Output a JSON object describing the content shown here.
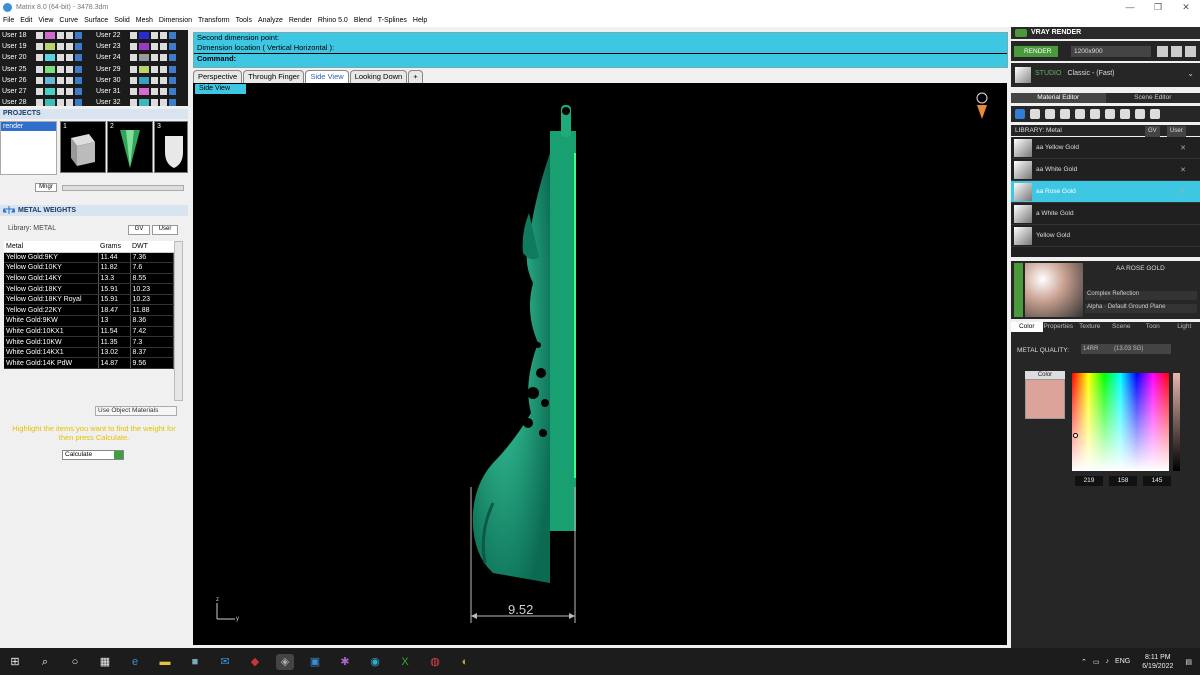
{
  "window": {
    "title": "Matrix 8.0 (64-bit) - 3478.3dm",
    "min": "—",
    "max": "❐",
    "close": "✕"
  },
  "menu": [
    "File",
    "Edit",
    "View",
    "Curve",
    "Surface",
    "Solid",
    "Mesh",
    "Dimension",
    "Transform",
    "Tools",
    "Analyze",
    "Render",
    "Rhino 5.0",
    "Blend",
    "T-Splines",
    "Help"
  ],
  "layers": {
    "left": [
      {
        "name": "User 18",
        "color": "#d26ad2"
      },
      {
        "name": "User 19",
        "color": "#b8d46a"
      },
      {
        "name": "User 20",
        "color": "#5ad4e0"
      },
      {
        "name": "User 25",
        "color": "#7ae07a"
      },
      {
        "name": "User 26",
        "color": "#6ab8d4"
      },
      {
        "name": "User 27",
        "color": "#4ad0c0"
      },
      {
        "name": "User 28",
        "color": "#3ac0b8"
      }
    ],
    "right": [
      {
        "name": "User 22",
        "color": "#2a2ad0"
      },
      {
        "name": "User 23",
        "color": "#9a3ac8"
      },
      {
        "name": "User 24",
        "color": "#9a9a9a"
      },
      {
        "name": "User 29",
        "color": "#c0d06a"
      },
      {
        "name": "User 30",
        "color": "#3aa0c0"
      },
      {
        "name": "User 31",
        "color": "#d66ad0"
      },
      {
        "name": "User 32",
        "color": "#3ab8c0"
      }
    ]
  },
  "projects": {
    "header": "PROJECTS",
    "item": "render",
    "thumbs": [
      "1",
      "2",
      "3"
    ],
    "mngr": "Mngr"
  },
  "metal_weights": {
    "header": "METAL WEIGHTS",
    "library": "Library: METAL",
    "gv": "GV",
    "user": "User",
    "columns": [
      "Metal",
      "Grams",
      "DWT"
    ],
    "rows": [
      [
        "Yellow Gold:9KY",
        "11.44",
        "7.36"
      ],
      [
        "Yellow Gold:10KY",
        "11.82",
        "7.6"
      ],
      [
        "Yellow Gold:14KY",
        "13.3",
        "8.55"
      ],
      [
        "Yellow Gold:18KY",
        "15.91",
        "10.23"
      ],
      [
        "Yellow Gold:18KY Royal",
        "15.91",
        "10.23"
      ],
      [
        "Yellow Gold:22KY",
        "18.47",
        "11.88"
      ],
      [
        "White Gold:9KW",
        "13",
        "8.36"
      ],
      [
        "White Gold:10KX1",
        "11.54",
        "7.42"
      ],
      [
        "White Gold:10KW",
        "11.35",
        "7.3"
      ],
      [
        "White Gold:14KX1",
        "13.02",
        "8.37"
      ],
      [
        "White Gold:14K PdW",
        "14.87",
        "9.56"
      ]
    ],
    "use_object": "Use Object Materials",
    "hint": "Highlight the items you want to find the weight for then press Calculate.",
    "calculate": "Calculate"
  },
  "command": {
    "line1": "Second dimension point:",
    "line2": "Dimension location ( Vertical  Horizontal ):",
    "prompt": "Command:"
  },
  "view_tabs": [
    "Perspective",
    "Through Finger",
    "Side View",
    "Looking Down",
    "+"
  ],
  "viewport": {
    "label": "Side View",
    "dimension": "9.52",
    "axis_z": "z",
    "axis_y": "y"
  },
  "vray": {
    "header": "VRAY RENDER",
    "render": "RENDER",
    "resolution": "1200x900",
    "preset_mode": "STUDIO",
    "preset": "Classic - (Fast)",
    "tabs": [
      "Material Editor",
      "Scene Editor"
    ],
    "library": "LIBRARY: Metal",
    "gv": "GV",
    "user": "User",
    "materials": [
      "aa Yellow Gold",
      "aa White Gold",
      "aa Rose Gold",
      "a White Gold",
      "Yellow Gold"
    ],
    "selected_material": "AA ROSE GOLD",
    "reflection": "Complex Reflection",
    "alpha": "Alpha",
    "ground": "Default Ground Plane",
    "prop_tabs": [
      "Color",
      "Properties",
      "Texture",
      "Scene",
      "Toon",
      "Light"
    ],
    "metal_quality_label": "METAL QUALITY:",
    "metal_quality": "14RR",
    "metal_quality_sub": "(13.03 SG)",
    "color_label": "Color",
    "swatch": "#dba39a",
    "r": "219",
    "g": "158",
    "b": "145"
  },
  "taskbar": {
    "lang": "ENG",
    "time": "8:11 PM",
    "date": "6/19/2022"
  }
}
